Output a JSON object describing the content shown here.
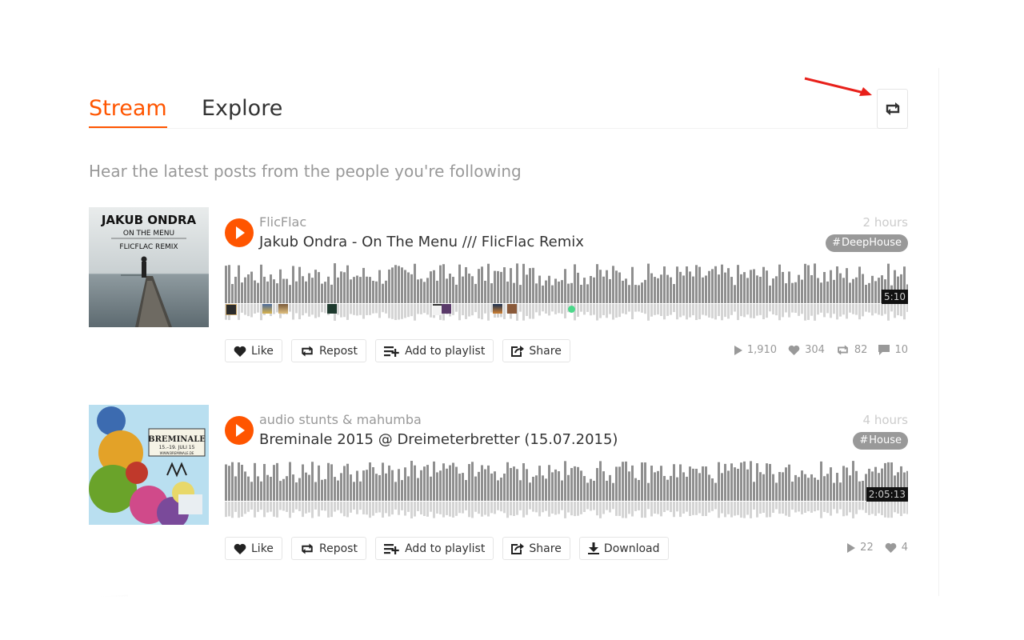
{
  "tabs": {
    "stream": "Stream",
    "explore": "Explore"
  },
  "subtitle": "Hear the latest posts from the people you're following",
  "actions": {
    "like": "Like",
    "repost": "Repost",
    "playlist": "Add to playlist",
    "share": "Share",
    "download": "Download"
  },
  "colors": {
    "accent": "#f50",
    "tag_bg": "#999",
    "wave": "#8f8f8f"
  },
  "items": [
    {
      "user": "FlicFlac",
      "title": "Jakub Ondra - On The Menu /// FlicFlac Remix",
      "time": "2 hours",
      "tag": "DeepHouse",
      "duration": "5:10",
      "art": {
        "artist": "JAKUB ONDRA",
        "release": "ON THE MENU",
        "version": "FLICFLAC REMIX"
      },
      "stats": {
        "plays": "1,910",
        "likes": "304",
        "reposts": "82",
        "comments": "10"
      }
    },
    {
      "user": "audio stunts & mahumba",
      "title": "Breminale 2015 @ Dreimeterbretter (15.07.2015)",
      "time": "4 hours",
      "tag": "House",
      "duration": "2:05:13",
      "art": {
        "name": "BREMINALE",
        "dates": "15.–19. JULI 15",
        "url": "WWW.BREMINALE.DE"
      },
      "stats": {
        "plays": "22",
        "likes": "4"
      }
    }
  ]
}
